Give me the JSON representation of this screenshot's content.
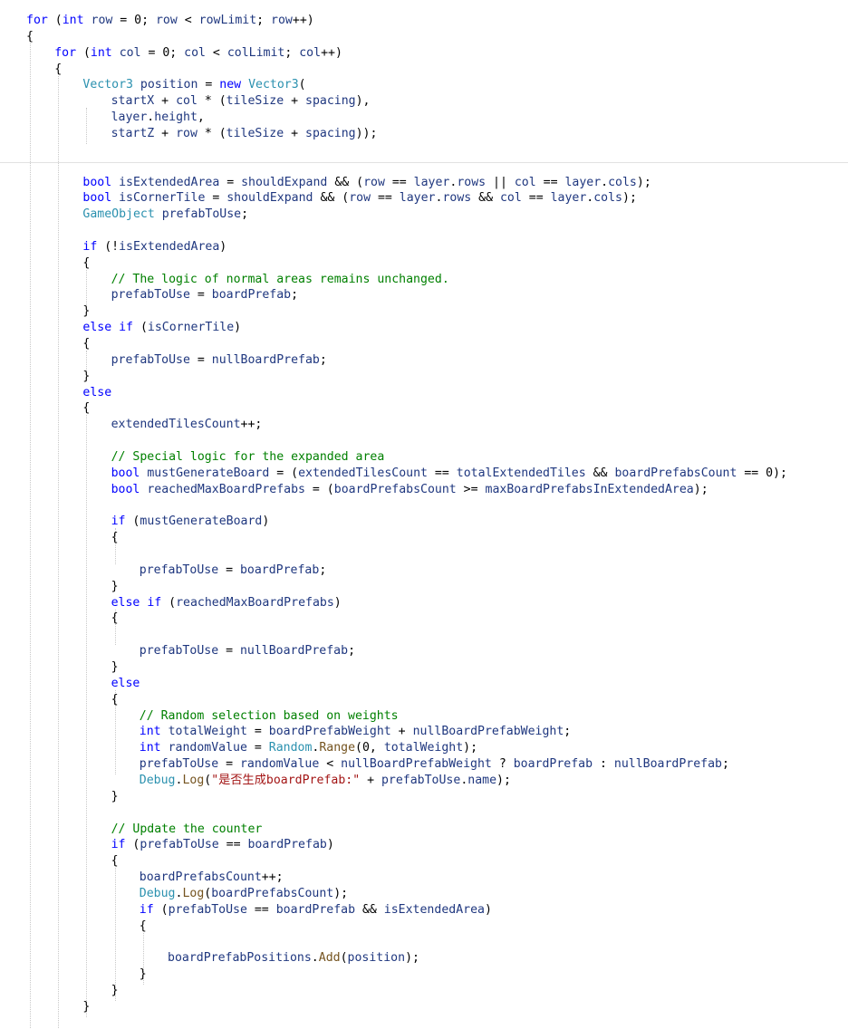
{
  "editor": {
    "colors": {
      "keyword": "#0000ff",
      "type": "#2b91af",
      "variable": "#1f377f",
      "comment": "#008000",
      "string": "#a31515",
      "method": "#74531f",
      "plain": "#000000"
    },
    "lines": [
      {
        "indent": 0,
        "tokens": [
          [
            "kw",
            "for"
          ],
          [
            "p",
            " ("
          ],
          [
            "kw",
            "int"
          ],
          [
            "p",
            " "
          ],
          [
            "var",
            "row"
          ],
          [
            "p",
            " = 0; "
          ],
          [
            "var",
            "row"
          ],
          [
            "p",
            " < "
          ],
          [
            "var",
            "rowLimit"
          ],
          [
            "p",
            "; "
          ],
          [
            "var",
            "row"
          ],
          [
            "p",
            "++)"
          ]
        ]
      },
      {
        "indent": 0,
        "tokens": [
          [
            "p",
            "{"
          ]
        ]
      },
      {
        "indent": 1,
        "tokens": [
          [
            "kw",
            "for"
          ],
          [
            "p",
            " ("
          ],
          [
            "kw",
            "int"
          ],
          [
            "p",
            " "
          ],
          [
            "var",
            "col"
          ],
          [
            "p",
            " = 0; "
          ],
          [
            "var",
            "col"
          ],
          [
            "p",
            " < "
          ],
          [
            "var",
            "colLimit"
          ],
          [
            "p",
            "; "
          ],
          [
            "var",
            "col"
          ],
          [
            "p",
            "++)"
          ]
        ]
      },
      {
        "indent": 1,
        "tokens": [
          [
            "p",
            "{"
          ]
        ]
      },
      {
        "indent": 2,
        "tokens": [
          [
            "type",
            "Vector3"
          ],
          [
            "p",
            " "
          ],
          [
            "var",
            "position"
          ],
          [
            "p",
            " = "
          ],
          [
            "kw",
            "new"
          ],
          [
            "p",
            " "
          ],
          [
            "type",
            "Vector3"
          ],
          [
            "p",
            "("
          ]
        ]
      },
      {
        "indent": 3,
        "tokens": [
          [
            "var",
            "startX"
          ],
          [
            "p",
            " + "
          ],
          [
            "var",
            "col"
          ],
          [
            "p",
            " * ("
          ],
          [
            "var",
            "tileSize"
          ],
          [
            "p",
            " + "
          ],
          [
            "var",
            "spacing"
          ],
          [
            "p",
            "),"
          ]
        ]
      },
      {
        "indent": 3,
        "tokens": [
          [
            "var",
            "layer"
          ],
          [
            "p",
            "."
          ],
          [
            "fld",
            "height"
          ],
          [
            "p",
            ","
          ]
        ]
      },
      {
        "indent": 3,
        "tokens": [
          [
            "var",
            "startZ"
          ],
          [
            "p",
            " + "
          ],
          [
            "var",
            "row"
          ],
          [
            "p",
            " * ("
          ],
          [
            "var",
            "tileSize"
          ],
          [
            "p",
            " + "
          ],
          [
            "var",
            "spacing"
          ],
          [
            "p",
            "));"
          ]
        ]
      },
      {
        "indent": 0,
        "tokens": []
      },
      {
        "indent": 0,
        "tokens": [],
        "separator": true
      },
      {
        "indent": 2,
        "tokens": [
          [
            "kw",
            "bool"
          ],
          [
            "p",
            " "
          ],
          [
            "var",
            "isExtendedArea"
          ],
          [
            "p",
            " = "
          ],
          [
            "var",
            "shouldExpand"
          ],
          [
            "p",
            " && ("
          ],
          [
            "var",
            "row"
          ],
          [
            "p",
            " == "
          ],
          [
            "var",
            "layer"
          ],
          [
            "p",
            "."
          ],
          [
            "fld",
            "rows"
          ],
          [
            "p",
            " || "
          ],
          [
            "var",
            "col"
          ],
          [
            "p",
            " == "
          ],
          [
            "var",
            "layer"
          ],
          [
            "p",
            "."
          ],
          [
            "fld",
            "cols"
          ],
          [
            "p",
            ");"
          ]
        ]
      },
      {
        "indent": 2,
        "tokens": [
          [
            "kw",
            "bool"
          ],
          [
            "p",
            " "
          ],
          [
            "var",
            "isCornerTile"
          ],
          [
            "p",
            " = "
          ],
          [
            "var",
            "shouldExpand"
          ],
          [
            "p",
            " && ("
          ],
          [
            "var",
            "row"
          ],
          [
            "p",
            " == "
          ],
          [
            "var",
            "layer"
          ],
          [
            "p",
            "."
          ],
          [
            "fld",
            "rows"
          ],
          [
            "p",
            " && "
          ],
          [
            "var",
            "col"
          ],
          [
            "p",
            " == "
          ],
          [
            "var",
            "layer"
          ],
          [
            "p",
            "."
          ],
          [
            "fld",
            "cols"
          ],
          [
            "p",
            ");"
          ]
        ]
      },
      {
        "indent": 2,
        "tokens": [
          [
            "type",
            "GameObject"
          ],
          [
            "p",
            " "
          ],
          [
            "var",
            "prefabToUse"
          ],
          [
            "p",
            ";"
          ]
        ]
      },
      {
        "indent": 0,
        "tokens": []
      },
      {
        "indent": 2,
        "tokens": [
          [
            "kw",
            "if"
          ],
          [
            "p",
            " (!"
          ],
          [
            "var",
            "isExtendedArea"
          ],
          [
            "p",
            ")"
          ]
        ]
      },
      {
        "indent": 2,
        "tokens": [
          [
            "p",
            "{"
          ]
        ]
      },
      {
        "indent": 3,
        "tokens": [
          [
            "cm",
            "// The logic of normal areas remains unchanged."
          ]
        ]
      },
      {
        "indent": 3,
        "tokens": [
          [
            "var",
            "prefabToUse"
          ],
          [
            "p",
            " = "
          ],
          [
            "var",
            "boardPrefab"
          ],
          [
            "p",
            ";"
          ]
        ]
      },
      {
        "indent": 2,
        "tokens": [
          [
            "p",
            "}"
          ]
        ]
      },
      {
        "indent": 2,
        "tokens": [
          [
            "kw",
            "else"
          ],
          [
            "p",
            " "
          ],
          [
            "kw",
            "if"
          ],
          [
            "p",
            " ("
          ],
          [
            "var",
            "isCornerTile"
          ],
          [
            "p",
            ")"
          ]
        ]
      },
      {
        "indent": 2,
        "tokens": [
          [
            "p",
            "{"
          ]
        ]
      },
      {
        "indent": 3,
        "tokens": [
          [
            "var",
            "prefabToUse"
          ],
          [
            "p",
            " = "
          ],
          [
            "var",
            "nullBoardPrefab"
          ],
          [
            "p",
            ";"
          ]
        ]
      },
      {
        "indent": 2,
        "tokens": [
          [
            "p",
            "}"
          ]
        ]
      },
      {
        "indent": 2,
        "tokens": [
          [
            "kw",
            "else"
          ]
        ]
      },
      {
        "indent": 2,
        "tokens": [
          [
            "p",
            "{"
          ]
        ]
      },
      {
        "indent": 3,
        "tokens": [
          [
            "var",
            "extendedTilesCount"
          ],
          [
            "p",
            "++;"
          ]
        ]
      },
      {
        "indent": 0,
        "tokens": []
      },
      {
        "indent": 3,
        "tokens": [
          [
            "cm",
            "// Special logic for the expanded area"
          ]
        ]
      },
      {
        "indent": 3,
        "tokens": [
          [
            "kw",
            "bool"
          ],
          [
            "p",
            " "
          ],
          [
            "var",
            "mustGenerateBoard"
          ],
          [
            "p",
            " = ("
          ],
          [
            "var",
            "extendedTilesCount"
          ],
          [
            "p",
            " == "
          ],
          [
            "var",
            "totalExtendedTiles"
          ],
          [
            "p",
            " && "
          ],
          [
            "var",
            "boardPrefabsCount"
          ],
          [
            "p",
            " == 0);"
          ]
        ]
      },
      {
        "indent": 3,
        "tokens": [
          [
            "kw",
            "bool"
          ],
          [
            "p",
            " "
          ],
          [
            "var",
            "reachedMaxBoardPrefabs"
          ],
          [
            "p",
            " = ("
          ],
          [
            "var",
            "boardPrefabsCount"
          ],
          [
            "p",
            " >= "
          ],
          [
            "var",
            "maxBoardPrefabsInExtendedArea"
          ],
          [
            "p",
            ");"
          ]
        ]
      },
      {
        "indent": 0,
        "tokens": []
      },
      {
        "indent": 3,
        "tokens": [
          [
            "kw",
            "if"
          ],
          [
            "p",
            " ("
          ],
          [
            "var",
            "mustGenerateBoard"
          ],
          [
            "p",
            ")"
          ]
        ]
      },
      {
        "indent": 3,
        "tokens": [
          [
            "p",
            "{"
          ]
        ]
      },
      {
        "indent": 0,
        "tokens": []
      },
      {
        "indent": 4,
        "tokens": [
          [
            "var",
            "prefabToUse"
          ],
          [
            "p",
            " = "
          ],
          [
            "var",
            "boardPrefab"
          ],
          [
            "p",
            ";"
          ]
        ]
      },
      {
        "indent": 3,
        "tokens": [
          [
            "p",
            "}"
          ]
        ]
      },
      {
        "indent": 3,
        "tokens": [
          [
            "kw",
            "else"
          ],
          [
            "p",
            " "
          ],
          [
            "kw",
            "if"
          ],
          [
            "p",
            " ("
          ],
          [
            "var",
            "reachedMaxBoardPrefabs"
          ],
          [
            "p",
            ")"
          ]
        ]
      },
      {
        "indent": 3,
        "tokens": [
          [
            "p",
            "{"
          ]
        ]
      },
      {
        "indent": 0,
        "tokens": []
      },
      {
        "indent": 4,
        "tokens": [
          [
            "var",
            "prefabToUse"
          ],
          [
            "p",
            " = "
          ],
          [
            "var",
            "nullBoardPrefab"
          ],
          [
            "p",
            ";"
          ]
        ]
      },
      {
        "indent": 3,
        "tokens": [
          [
            "p",
            "}"
          ]
        ]
      },
      {
        "indent": 3,
        "tokens": [
          [
            "kw",
            "else"
          ]
        ]
      },
      {
        "indent": 3,
        "tokens": [
          [
            "p",
            "{"
          ]
        ]
      },
      {
        "indent": 4,
        "tokens": [
          [
            "cm",
            "// Random selection based on weights"
          ]
        ]
      },
      {
        "indent": 4,
        "tokens": [
          [
            "kw",
            "int"
          ],
          [
            "p",
            " "
          ],
          [
            "var",
            "totalWeight"
          ],
          [
            "p",
            " = "
          ],
          [
            "var",
            "boardPrefabWeight"
          ],
          [
            "p",
            " + "
          ],
          [
            "var",
            "nullBoardPrefabWeight"
          ],
          [
            "p",
            ";"
          ]
        ]
      },
      {
        "indent": 4,
        "tokens": [
          [
            "kw",
            "int"
          ],
          [
            "p",
            " "
          ],
          [
            "var",
            "randomValue"
          ],
          [
            "p",
            " = "
          ],
          [
            "type",
            "Random"
          ],
          [
            "p",
            "."
          ],
          [
            "method",
            "Range"
          ],
          [
            "p",
            "(0, "
          ],
          [
            "var",
            "totalWeight"
          ],
          [
            "p",
            ");"
          ]
        ]
      },
      {
        "indent": 4,
        "tokens": [
          [
            "var",
            "prefabToUse"
          ],
          [
            "p",
            " = "
          ],
          [
            "var",
            "randomValue"
          ],
          [
            "p",
            " < "
          ],
          [
            "var",
            "nullBoardPrefabWeight"
          ],
          [
            "p",
            " ? "
          ],
          [
            "var",
            "boardPrefab"
          ],
          [
            "p",
            " : "
          ],
          [
            "var",
            "nullBoardPrefab"
          ],
          [
            "p",
            ";"
          ]
        ]
      },
      {
        "indent": 4,
        "tokens": [
          [
            "type",
            "Debug"
          ],
          [
            "p",
            "."
          ],
          [
            "method",
            "Log"
          ],
          [
            "p",
            "("
          ],
          [
            "str",
            "\"是否生成boardPrefab:\""
          ],
          [
            "p",
            " + "
          ],
          [
            "var",
            "prefabToUse"
          ],
          [
            "p",
            "."
          ],
          [
            "fld",
            "name"
          ],
          [
            "p",
            ");"
          ]
        ]
      },
      {
        "indent": 3,
        "tokens": [
          [
            "p",
            "}"
          ]
        ]
      },
      {
        "indent": 0,
        "tokens": []
      },
      {
        "indent": 3,
        "tokens": [
          [
            "cm",
            "// Update the counter"
          ]
        ]
      },
      {
        "indent": 3,
        "tokens": [
          [
            "kw",
            "if"
          ],
          [
            "p",
            " ("
          ],
          [
            "var",
            "prefabToUse"
          ],
          [
            "p",
            " == "
          ],
          [
            "var",
            "boardPrefab"
          ],
          [
            "p",
            ")"
          ]
        ]
      },
      {
        "indent": 3,
        "tokens": [
          [
            "p",
            "{"
          ]
        ]
      },
      {
        "indent": 4,
        "tokens": [
          [
            "var",
            "boardPrefabsCount"
          ],
          [
            "p",
            "++;"
          ]
        ]
      },
      {
        "indent": 4,
        "tokens": [
          [
            "type",
            "Debug"
          ],
          [
            "p",
            "."
          ],
          [
            "method",
            "Log"
          ],
          [
            "p",
            "("
          ],
          [
            "var",
            "boardPrefabsCount"
          ],
          [
            "p",
            ");"
          ]
        ]
      },
      {
        "indent": 4,
        "tokens": [
          [
            "kw",
            "if"
          ],
          [
            "p",
            " ("
          ],
          [
            "var",
            "prefabToUse"
          ],
          [
            "p",
            " == "
          ],
          [
            "var",
            "boardPrefab"
          ],
          [
            "p",
            " && "
          ],
          [
            "var",
            "isExtendedArea"
          ],
          [
            "p",
            ")"
          ]
        ]
      },
      {
        "indent": 4,
        "tokens": [
          [
            "p",
            "{"
          ]
        ]
      },
      {
        "indent": 0,
        "tokens": []
      },
      {
        "indent": 5,
        "tokens": [
          [
            "var",
            "boardPrefabPositions"
          ],
          [
            "p",
            "."
          ],
          [
            "method",
            "Add"
          ],
          [
            "p",
            "("
          ],
          [
            "var",
            "position"
          ],
          [
            "p",
            ");"
          ]
        ]
      },
      {
        "indent": 4,
        "tokens": [
          [
            "p",
            "}"
          ]
        ]
      },
      {
        "indent": 3,
        "tokens": [
          [
            "p",
            "}"
          ]
        ]
      },
      {
        "indent": 2,
        "tokens": [
          [
            "p",
            "}"
          ]
        ]
      }
    ]
  }
}
